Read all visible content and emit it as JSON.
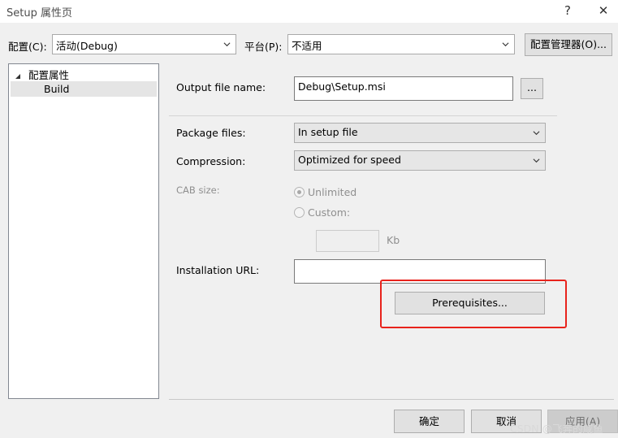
{
  "window": {
    "title": "Setup 属性页",
    "help_glyph": "?",
    "close_glyph": "✕"
  },
  "toolbar": {
    "config_label": "配置(C):",
    "config_value": "活动(Debug)",
    "platform_label": "平台(P):",
    "platform_value": "不适用",
    "config_manager_label": "配置管理器(O)..."
  },
  "tree": {
    "root_label": "配置属性",
    "child_label": "Build"
  },
  "form": {
    "output_label": "Output file name:",
    "output_value": "Debug\\Setup.msi",
    "browse_label": "...",
    "package_label": "Package files:",
    "package_value": "In setup file",
    "compression_label": "Compression:",
    "compression_value": "Optimized for speed",
    "cab_label": "CAB size:",
    "unlimited_label": "Unlimited",
    "custom_label": "Custom:",
    "custom_value": "",
    "kb_label": "Kb",
    "install_url_label": "Installation URL:",
    "install_url_value": "",
    "prerequisites_label": "Prerequisites..."
  },
  "footer": {
    "ok_label": "确定",
    "cancel_label": "取消",
    "apply_label": "应用(A)",
    "watermark": "CSDN @飞奔的咸鱼"
  },
  "colors": {
    "highlight": "#e8231c",
    "window_bg": "#f0f0f0"
  }
}
